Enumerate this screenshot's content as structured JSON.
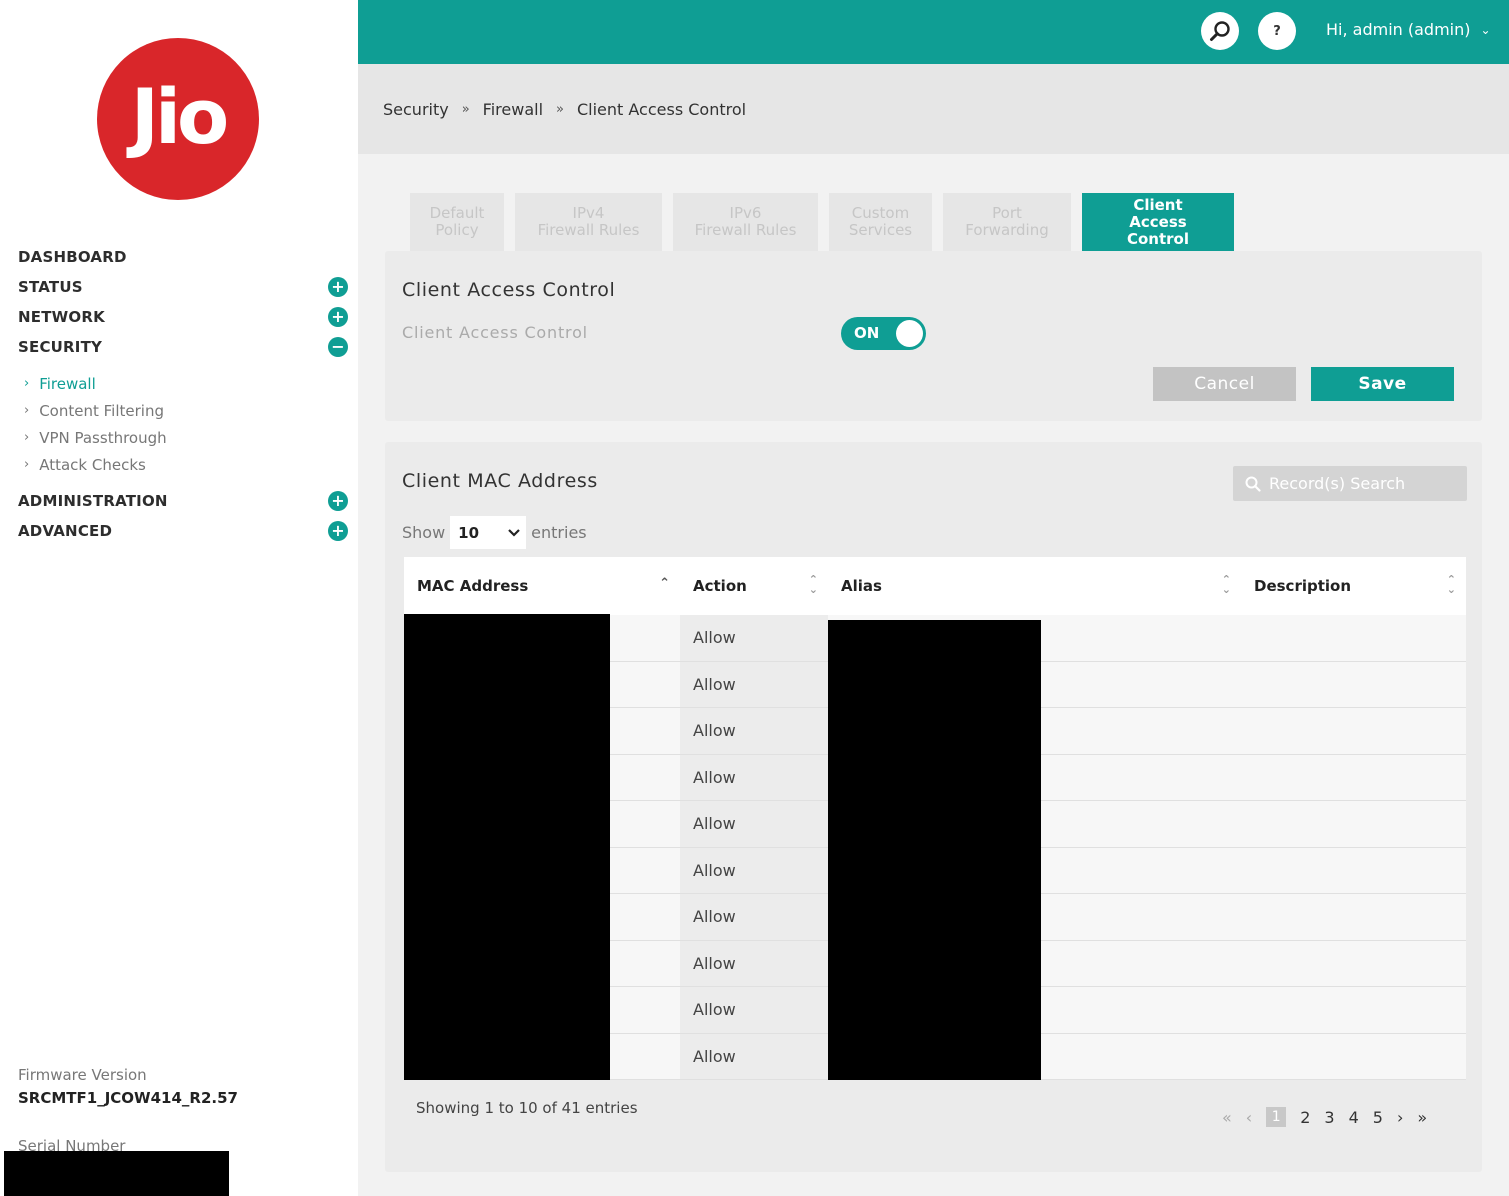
{
  "brand": {
    "logo_text": "Jio",
    "color": "#d9262a",
    "accent": "#0f9e94"
  },
  "header": {
    "search_icon": "search-icon",
    "help_label": "?",
    "user_label": "Hi, admin (admin)"
  },
  "sidebar": {
    "items": [
      {
        "label": "DASHBOARD",
        "toggle": ""
      },
      {
        "label": "STATUS",
        "toggle": "+"
      },
      {
        "label": "NETWORK",
        "toggle": "+"
      },
      {
        "label": "SECURITY",
        "toggle": "−"
      },
      {
        "label": "ADMINISTRATION",
        "toggle": "+"
      },
      {
        "label": "ADVANCED",
        "toggle": "+"
      }
    ],
    "security_sub": [
      {
        "label": "Firewall",
        "active": true
      },
      {
        "label": "Content Filtering",
        "active": false
      },
      {
        "label": "VPN Passthrough",
        "active": false
      },
      {
        "label": "Attack Checks",
        "active": false
      }
    ],
    "firmware_label": "Firmware Version",
    "firmware_value": "SRCMTF1_JCOW414_R2.57",
    "serial_label": "Serial Number"
  },
  "breadcrumb": [
    "Security",
    "Firewall",
    "Client Access Control"
  ],
  "tabs": [
    {
      "line1": "Default",
      "line2": "Policy",
      "active": false
    },
    {
      "line1": "IPv4",
      "line2": "Firewall Rules",
      "active": false
    },
    {
      "line1": "IPv6",
      "line2": "Firewall Rules",
      "active": false
    },
    {
      "line1": "Custom",
      "line2": "Services",
      "active": false
    },
    {
      "line1": "Port",
      "line2": "Forwarding",
      "active": false
    },
    {
      "line1": "Client",
      "line2": "Access Control",
      "active": true
    }
  ],
  "cac": {
    "title": "Client Access Control",
    "field_label": "Client Access Control",
    "toggle_label": "ON",
    "cancel_label": "Cancel",
    "save_label": "Save"
  },
  "mac": {
    "title": "Client MAC Address",
    "search_placeholder": "Record(s) Search",
    "show_label": "Show",
    "entries_label": "entries",
    "page_size": "10",
    "columns": [
      "MAC Address",
      "Action",
      "Alias",
      "Description"
    ],
    "rows": [
      {
        "action": "Allow"
      },
      {
        "action": "Allow"
      },
      {
        "action": "Allow"
      },
      {
        "action": "Allow"
      },
      {
        "action": "Allow"
      },
      {
        "action": "Allow"
      },
      {
        "action": "Allow"
      },
      {
        "action": "Allow"
      },
      {
        "action": "Allow"
      },
      {
        "action": "Allow"
      }
    ],
    "info": "Showing 1 to 10 of 41 entries",
    "pages": [
      "1",
      "2",
      "3",
      "4",
      "5"
    ],
    "current_page": "1"
  }
}
